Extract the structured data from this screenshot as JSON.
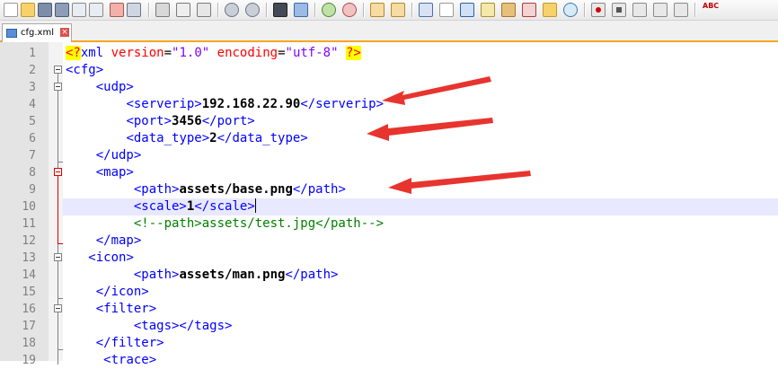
{
  "toolbar": {
    "buttons": [
      "new-file-icon",
      "open-file-icon",
      "save-icon",
      "save-all-icon",
      "close-icon",
      "close-all-icon",
      "print-icon",
      "cut-icon",
      "copy-icon",
      "paste-icon",
      "undo-icon",
      "redo-icon",
      "find-icon",
      "replace-icon",
      "zoom-in-icon",
      "zoom-out-icon",
      "sync-vertical-icon",
      "sync-horizontal-icon",
      "word-wrap-icon",
      "show-all-chars-icon",
      "indent-guide-icon",
      "user-language-icon",
      "doc-map-icon",
      "function-list-icon",
      "folder-workspace-icon",
      "monitoring-icon",
      "record-macro-icon",
      "stop-record-icon",
      "play-macro-icon",
      "run-macro-multiple-icon",
      "save-macro-icon",
      "spell-check-icon"
    ],
    "spell_label": "ABC"
  },
  "tab": {
    "filename": "cfg.xml",
    "close_glyph": "×"
  },
  "editor": {
    "lines": [
      {
        "n": "1"
      },
      {
        "n": "2"
      },
      {
        "n": "3"
      },
      {
        "n": "4"
      },
      {
        "n": "5"
      },
      {
        "n": "6"
      },
      {
        "n": "7"
      },
      {
        "n": "8"
      },
      {
        "n": "9"
      },
      {
        "n": "10"
      },
      {
        "n": "11"
      },
      {
        "n": "12"
      },
      {
        "n": "13"
      },
      {
        "n": "14"
      },
      {
        "n": "15"
      },
      {
        "n": "16"
      },
      {
        "n": "17"
      },
      {
        "n": "18"
      },
      {
        "n": "19"
      }
    ],
    "code": {
      "l1_pi_open": "<?",
      "l1_xml": "xml",
      "l1_attr1": "version",
      "l1_eq1": "=",
      "l1_val1": "\"1.0\"",
      "l1_attr2": "encoding",
      "l1_eq2": "=",
      "l1_val2": "\"utf-8\"",
      "l1_pi_close": "?>",
      "l2": "<cfg>",
      "l3": "<udp>",
      "l4_open": "<serverip>",
      "l4_text": "192.168.22.90",
      "l4_close": "</serverip>",
      "l5_open": "<port>",
      "l5_text": "3456",
      "l5_close": "</port>",
      "l6_open": "<data_type>",
      "l6_text": "2",
      "l6_close": "</data_type>",
      "l7": "</udp>",
      "l8": "<map>",
      "l9_open": "<path>",
      "l9_text": "assets/base.png",
      "l9_close": "</path>",
      "l10_open": "<scale>",
      "l10_text": "1",
      "l10_close": "</scale>",
      "l11": "<!--path>assets/test.jpg</path-->",
      "l12": "</map>",
      "l13": "<icon>",
      "l14_open": "<path>",
      "l14_text": "assets/man.png",
      "l14_close": "</path>",
      "l15": "</icon>",
      "l16": "<filter>",
      "l17": "<tags></tags>",
      "l18": "</filter>",
      "l19": "<trace>"
    }
  },
  "colors": {
    "tag": "#0000ff",
    "attribute": "#ff0000",
    "attribute_value": "#8000ff",
    "comment": "#008000",
    "annotation_arrow": "#e8342e",
    "current_line": "#e8e8ff",
    "tab_accent": "#f5a623"
  }
}
